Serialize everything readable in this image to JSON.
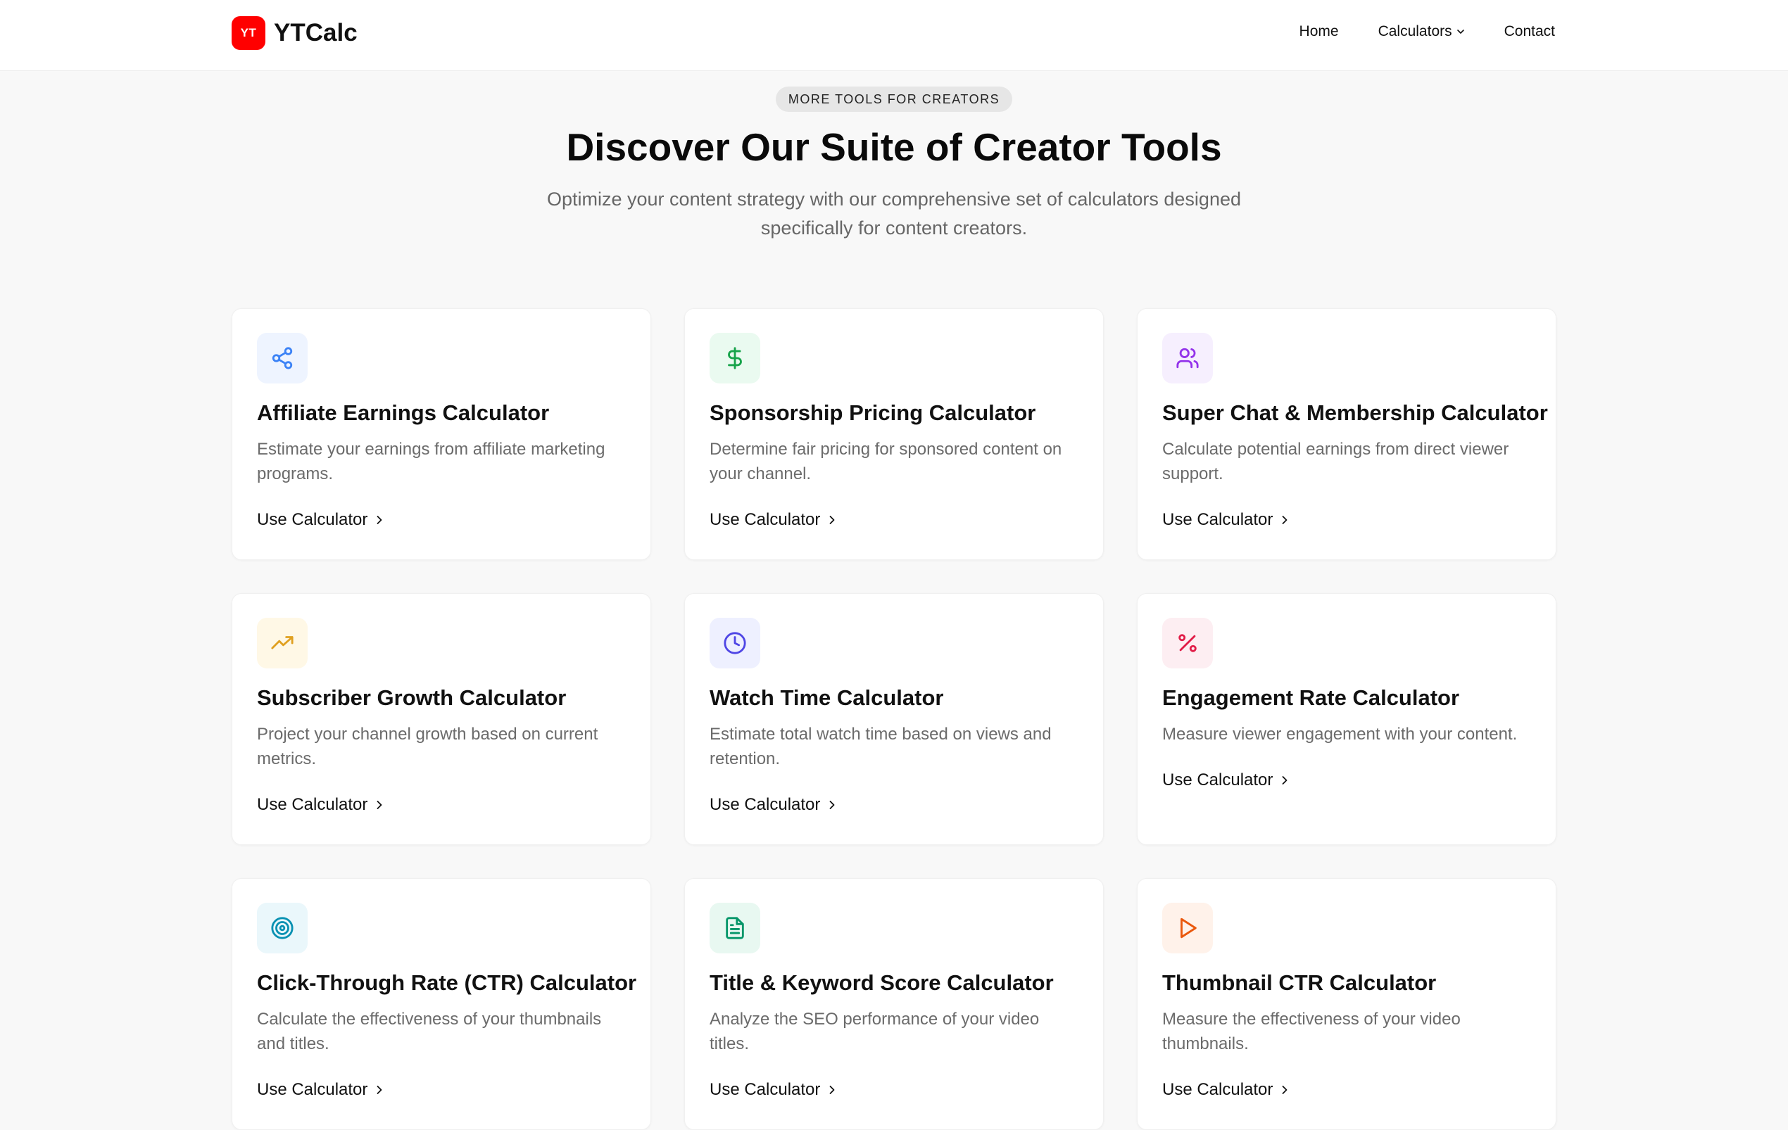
{
  "brand": {
    "logo_text": "YT",
    "name": "YTCalc"
  },
  "nav": {
    "home": "Home",
    "calculators": "Calculators",
    "contact": "Contact"
  },
  "hero": {
    "badge": "MORE TOOLS FOR CREATORS",
    "title": "Discover Our Suite of Creator Tools",
    "subtitle": "Optimize your content strategy with our comprehensive set of calculators designed specifically for content creators."
  },
  "cards": [
    {
      "title": "Affiliate Earnings Calculator",
      "desc": "Estimate your earnings from affiliate marketing programs.",
      "link": "Use Calculator",
      "icon": "share-icon",
      "icon_color": "#3b82f6",
      "icon_bg": "#eef4ff"
    },
    {
      "title": "Sponsorship Pricing Calculator",
      "desc": "Determine fair pricing for sponsored content on your channel.",
      "link": "Use Calculator",
      "icon": "dollar-icon",
      "icon_color": "#16a34a",
      "icon_bg": "#eafaf0"
    },
    {
      "title": "Super Chat & Membership Calculator",
      "desc": "Calculate potential earnings from direct viewer support.",
      "link": "Use Calculator",
      "icon": "users-icon",
      "icon_color": "#9333ea",
      "icon_bg": "#f6effe"
    },
    {
      "title": "Subscriber Growth Calculator",
      "desc": "Project your channel growth based on current metrics.",
      "link": "Use Calculator",
      "icon": "trending-up-icon",
      "icon_color": "#e0a020",
      "icon_bg": "#fff8e6"
    },
    {
      "title": "Watch Time Calculator",
      "desc": "Estimate total watch time based on views and retention.",
      "link": "Use Calculator",
      "icon": "clock-icon",
      "icon_color": "#4f46e5",
      "icon_bg": "#eef0ff"
    },
    {
      "title": "Engagement Rate Calculator",
      "desc": "Measure viewer engagement with your content.",
      "link": "Use Calculator",
      "icon": "percent-icon",
      "icon_color": "#e11d48",
      "icon_bg": "#fdeef2"
    },
    {
      "title": "Click-Through Rate (CTR) Calculator",
      "desc": "Calculate the effectiveness of your thumbnails and titles.",
      "link": "Use Calculator",
      "icon": "target-icon",
      "icon_color": "#0891b2",
      "icon_bg": "#eaf7fb"
    },
    {
      "title": "Title & Keyword Score Calculator",
      "desc": "Analyze the SEO performance of your video titles.",
      "link": "Use Calculator",
      "icon": "file-text-icon",
      "icon_color": "#059669",
      "icon_bg": "#e8f8f1"
    },
    {
      "title": "Thumbnail CTR Calculator",
      "desc": "Measure the effectiveness of your video thumbnails.",
      "link": "Use Calculator",
      "icon": "play-icon",
      "icon_color": "#ea580c",
      "icon_bg": "#fff2ea"
    }
  ]
}
